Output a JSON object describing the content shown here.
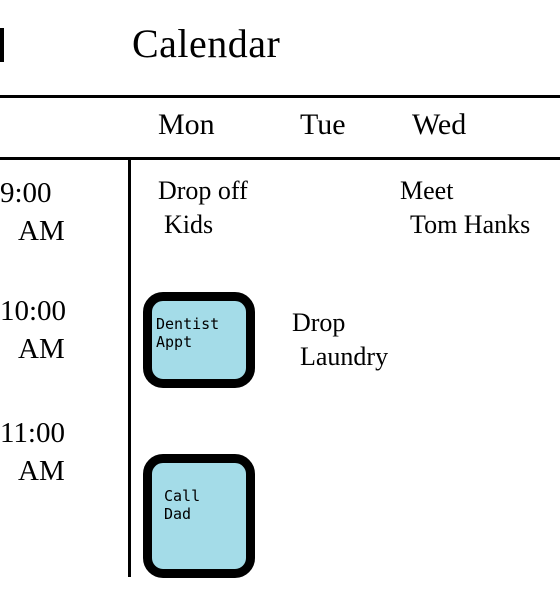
{
  "header": {
    "title": "Calendar"
  },
  "days": [
    "Mon",
    "Tue",
    "Wed"
  ],
  "times": [
    {
      "hour": "9:00",
      "ampm": "AM"
    },
    {
      "hour": "10:00",
      "ampm": "AM"
    },
    {
      "hour": "11:00",
      "ampm": "AM"
    }
  ],
  "events": {
    "drop_off_kids": {
      "line1": "Drop off",
      "line2": "Kids"
    },
    "meet_tom_hanks": {
      "line1": "Meet",
      "line2": "Tom Hanks"
    },
    "drop_laundry": {
      "line1": "Drop",
      "line2": "Laundry"
    }
  },
  "stickies": {
    "dentist": {
      "line1": "Dentist",
      "line2": "Appt",
      "color": "#a4dce8"
    },
    "call_dad": {
      "line1": "Call",
      "line2": "Dad",
      "color": "#a4dce8"
    }
  }
}
